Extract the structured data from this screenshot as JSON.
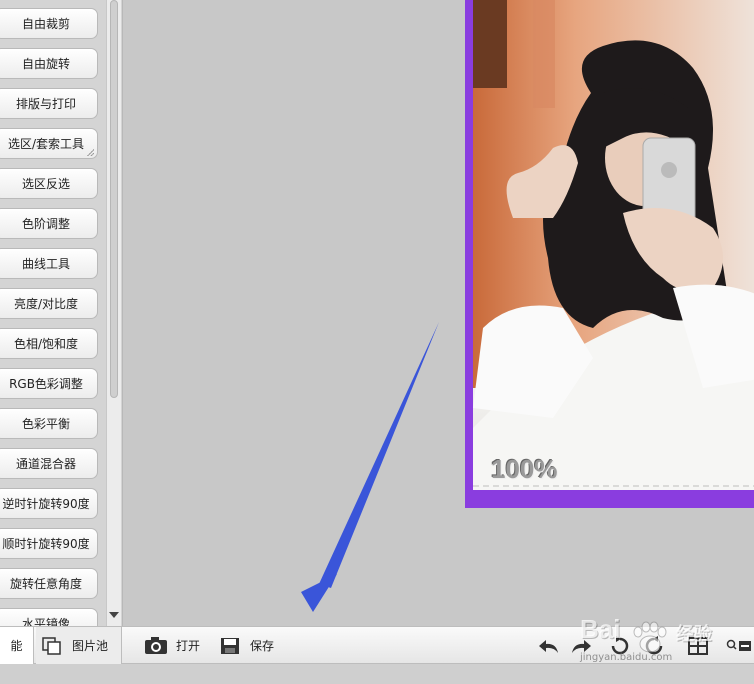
{
  "sidebar": {
    "tools": [
      {
        "label": "自由裁剪"
      },
      {
        "label": "自由旋转"
      },
      {
        "label": "排版与打印"
      },
      {
        "label": "选区/套索工具"
      },
      {
        "label": "选区反选"
      },
      {
        "label": "色阶调整"
      },
      {
        "label": "曲线工具"
      },
      {
        "label": "亮度/对比度"
      },
      {
        "label": "色相/饱和度"
      },
      {
        "label": "RGB色彩调整"
      },
      {
        "label": "色彩平衡"
      },
      {
        "label": "通道混合器"
      },
      {
        "label": "逆时针旋转90度"
      },
      {
        "label": "顺时针旋转90度"
      },
      {
        "label": "旋转任意角度"
      },
      {
        "label": "水平镜像"
      }
    ]
  },
  "canvas": {
    "zoom_label": "100%"
  },
  "toolbar": {
    "functions_tab": "能",
    "image_pool_label": "图片池",
    "open_label": "打开",
    "save_label": "保存"
  },
  "watermark": {
    "brand": "Bai",
    "brand_suffix": "经验",
    "url": "jingyan.baidu.com"
  },
  "colors": {
    "photo_border": "#8a3ddf",
    "annotation_arrow": "#3a55d9"
  }
}
